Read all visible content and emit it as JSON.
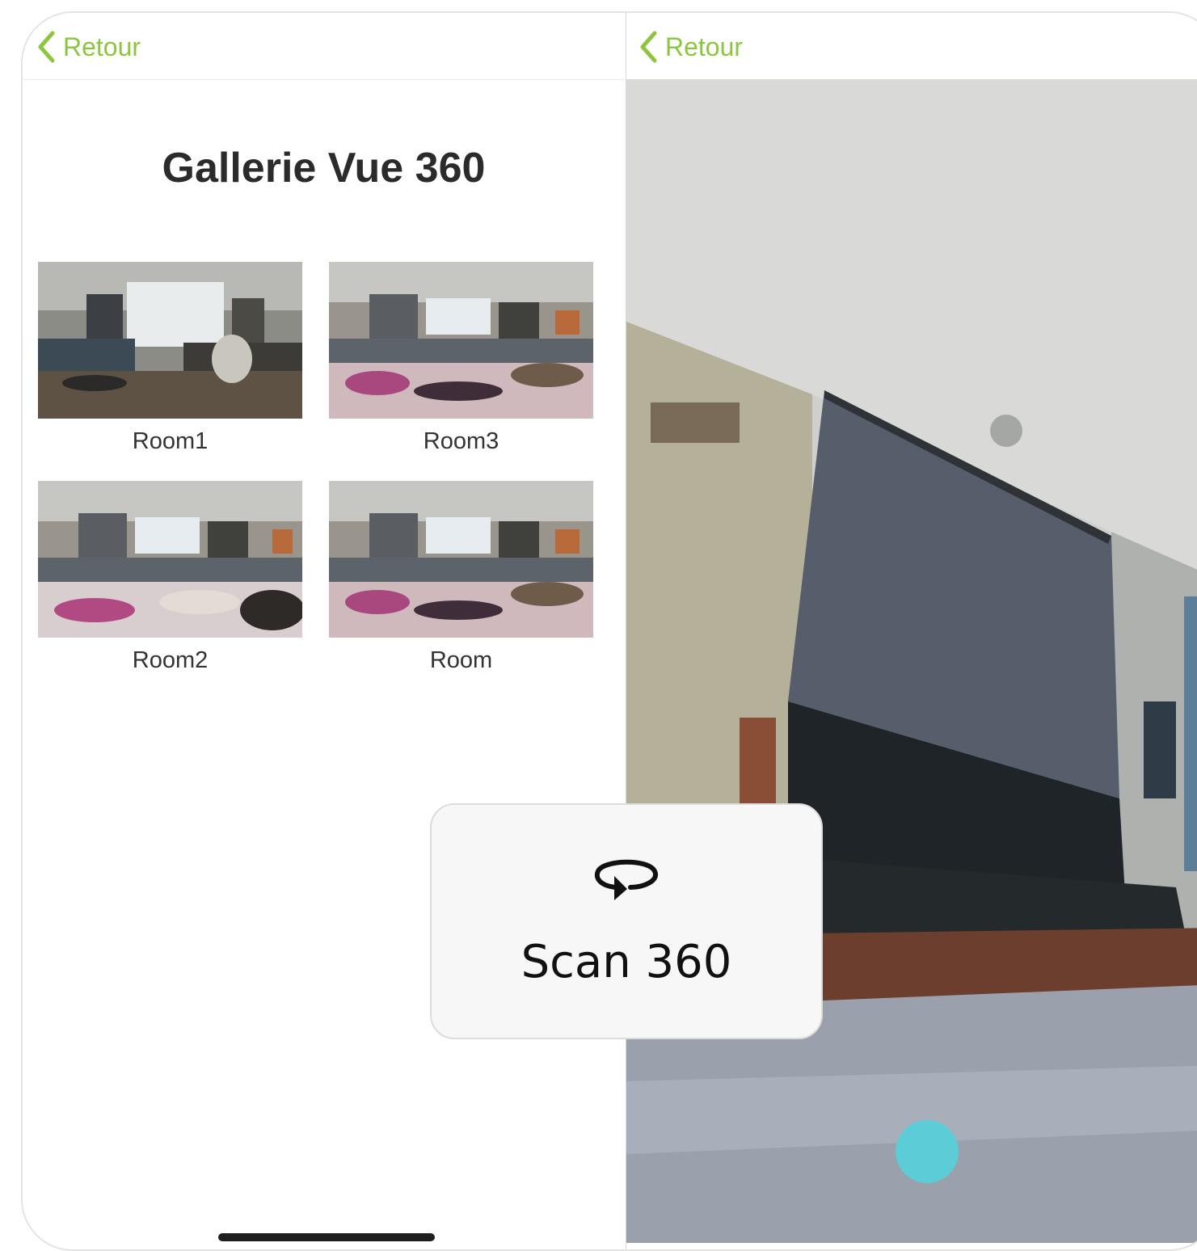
{
  "left_screen": {
    "back_label": "Retour",
    "title": "Gallerie Vue 360",
    "rooms": [
      {
        "label": "Room1"
      },
      {
        "label": "Room3"
      },
      {
        "label": "Room2"
      },
      {
        "label": "Room"
      }
    ]
  },
  "right_screen": {
    "back_label": "Retour"
  },
  "scan_card": {
    "icon": "rotate-360-icon",
    "label": "Scan 360"
  },
  "colors": {
    "accent_green": "#8cc63f",
    "capture_dot": "#5ccdd6"
  }
}
